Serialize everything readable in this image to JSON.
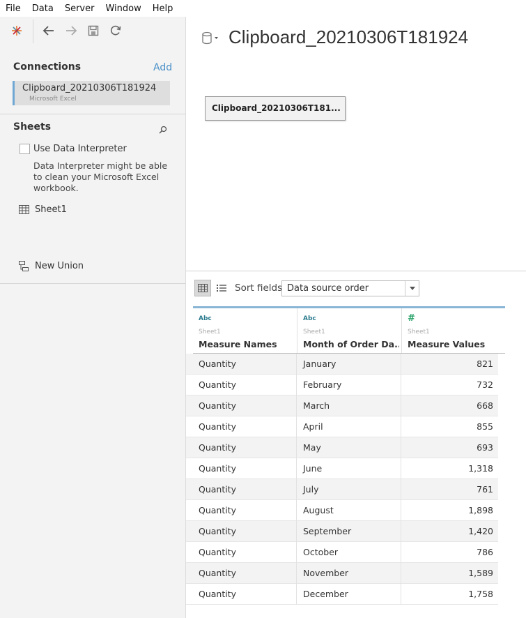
{
  "menu": [
    "File",
    "Data",
    "Server",
    "Window",
    "Help"
  ],
  "connections": {
    "title": "Connections",
    "add_label": "Add",
    "item": {
      "name": "Clipboard_20210306T181924",
      "type": "Microsoft Excel"
    }
  },
  "sheets": {
    "title": "Sheets",
    "interpreter_label": "Use Data Interpreter",
    "interpreter_desc": "Data Interpreter might be able to clean your Microsoft Excel workbook.",
    "sheet_name": "Sheet1",
    "new_union": "New Union"
  },
  "canvas": {
    "title": "Clipboard_20210306T181924",
    "table_chip": "Clipboard_20210306T181..."
  },
  "gridbar": {
    "sort_label": "Sort fields",
    "sort_value": "Data source order"
  },
  "columns": [
    {
      "type": "Abc",
      "source": "Sheet1",
      "name": "Measure Names"
    },
    {
      "type": "Abc",
      "source": "Sheet1",
      "name": "Month of Order Da..."
    },
    {
      "type": "#",
      "source": "Sheet1",
      "name": "Measure Values"
    }
  ],
  "rows": [
    [
      "Quantity",
      "January",
      "821"
    ],
    [
      "Quantity",
      "February",
      "732"
    ],
    [
      "Quantity",
      "March",
      "668"
    ],
    [
      "Quantity",
      "April",
      "855"
    ],
    [
      "Quantity",
      "May",
      "693"
    ],
    [
      "Quantity",
      "June",
      "1,318"
    ],
    [
      "Quantity",
      "July",
      "761"
    ],
    [
      "Quantity",
      "August",
      "1,898"
    ],
    [
      "Quantity",
      "September",
      "1,420"
    ],
    [
      "Quantity",
      "October",
      "786"
    ],
    [
      "Quantity",
      "November",
      "1,589"
    ],
    [
      "Quantity",
      "December",
      "1,758"
    ]
  ],
  "colors": {
    "accent": "#4a90c8",
    "header_bar": "#8ab6d6"
  }
}
